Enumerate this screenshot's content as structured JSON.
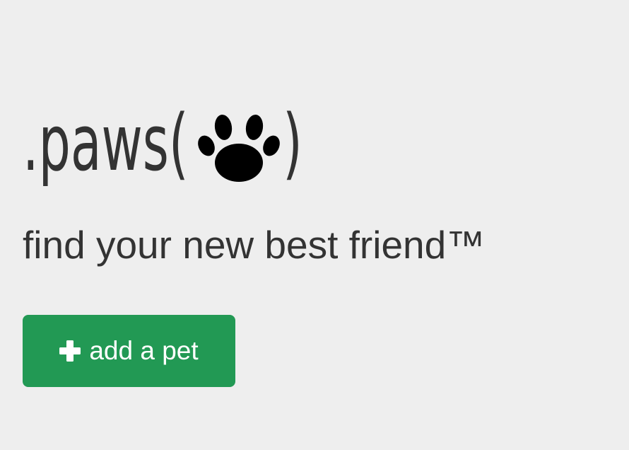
{
  "brand": {
    "prefix": ".paws(",
    "suffix": ")",
    "logo_icon": "paw-icon"
  },
  "hero": {
    "tagline": "find your new best friend™"
  },
  "actions": {
    "add_pet_label": "add a pet",
    "add_pet_icon": "plus-icon",
    "add_pet_color": "#229954"
  },
  "colors": {
    "background": "#eeeeee",
    "text": "#333333"
  }
}
